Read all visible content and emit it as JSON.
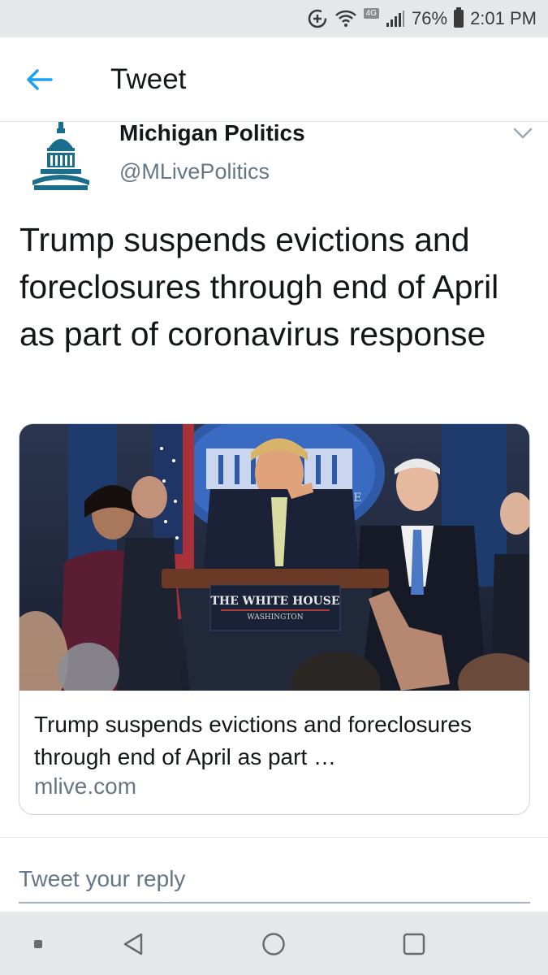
{
  "status_bar": {
    "network": "4G",
    "battery": "76%",
    "time": "2:01 PM",
    "icons": [
      "data-saver-icon",
      "wifi-icon",
      "signal-icon",
      "battery-icon"
    ]
  },
  "header": {
    "title": "Tweet",
    "back_icon": "arrow-left-icon",
    "accent": "#1da1f2"
  },
  "tweet": {
    "author_name": "Michigan Politics",
    "author_handle": "@MLivePolitics",
    "avatar_icon": "capitol-dome-icon",
    "avatar_color": "#1a6e8c",
    "menu_icon": "chevron-down-icon",
    "text": "Trump suspends evictions and foreclosures through end of April as part of coronavirus response"
  },
  "card": {
    "image_sign_line1": "THE WHITE HOUSE",
    "image_sign_line2": "WASHINGTON",
    "image_backdrop_text": "USE",
    "title": "Trump suspends evictions and foreclosures through end of April as part …",
    "domain": "mlive.com"
  },
  "reply": {
    "placeholder": "Tweet your reply"
  },
  "nav_bar": {
    "icons": [
      "dot-icon",
      "back-triangle-icon",
      "home-circle-icon",
      "recents-square-icon"
    ]
  }
}
